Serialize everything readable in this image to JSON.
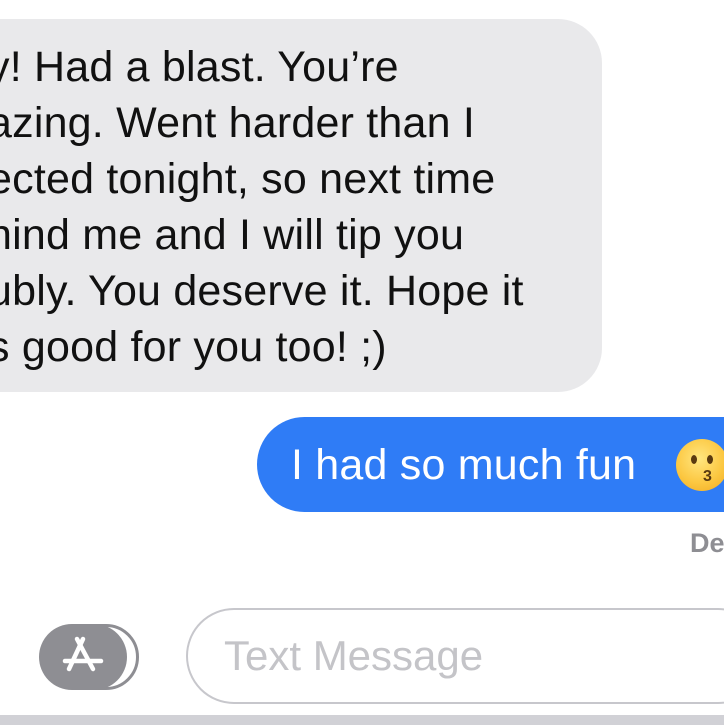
{
  "conversation": {
    "received_message": {
      "lines": [
        "y! Had a blast. You’re",
        "azing. Went harder than I",
        "ected tonight, so next time",
        "nind me and I will tip you",
        "ubly. You deserve it. Hope it",
        "s good for you too! ;)"
      ]
    },
    "sent_message": {
      "text": "I had so much fun",
      "emoji": "kissing-face-emoji"
    },
    "delivery_status": "De"
  },
  "composer": {
    "app_button_icon": "app-store-icon",
    "placeholder": "Text Message"
  },
  "colors": {
    "received_bubble": "#e9e9eb",
    "sent_bubble": "#2f7cf6",
    "sent_text": "#ffffff",
    "status_text": "#8e8e93",
    "placeholder_text": "#c4c4c8"
  }
}
